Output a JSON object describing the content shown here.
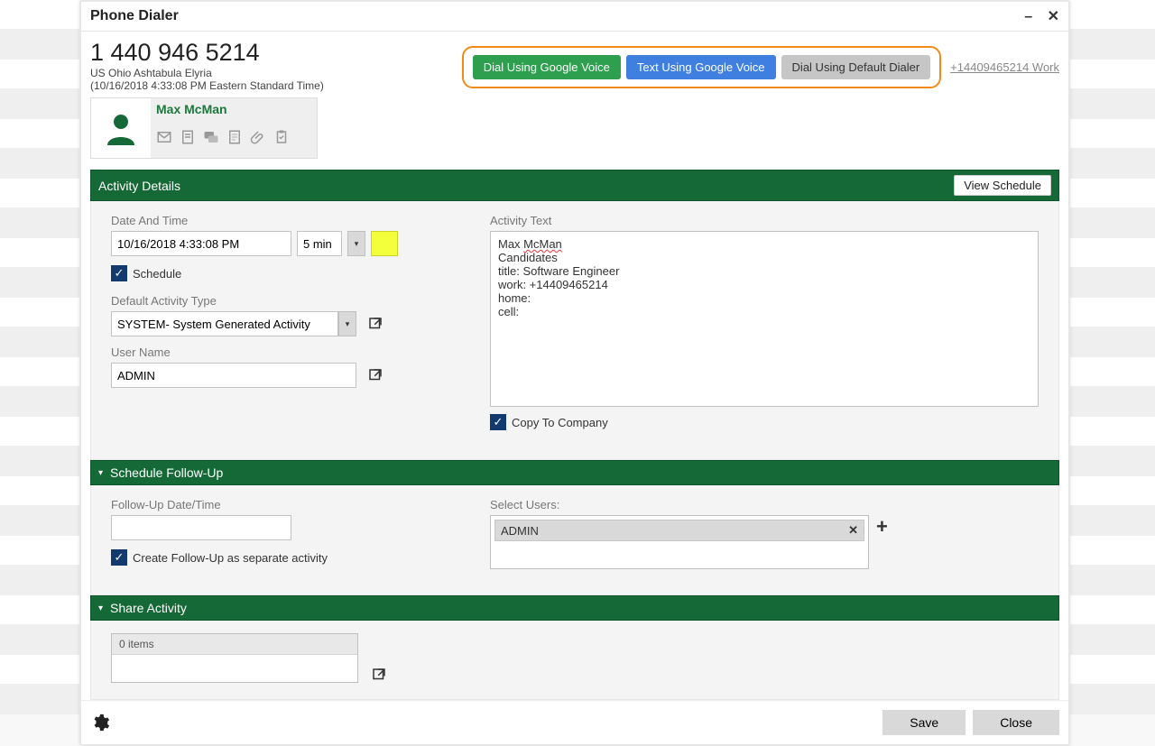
{
  "dialog": {
    "title": "Phone Dialer",
    "phone_display": "1 440 946 5214",
    "location": "US Ohio Ashtabula Elyria",
    "timestamp": "(10/16/2018 4:33:08 PM Eastern Standard Time)",
    "dial_google_voice": "Dial Using Google Voice",
    "text_google_voice": "Text Using Google Voice",
    "dial_default": "Dial Using Default Dialer",
    "phone_link": "+14409465214 Work"
  },
  "contact": {
    "name": "Max McMan"
  },
  "activity": {
    "section_title": "Activity Details",
    "view_schedule": "View Schedule",
    "date_label": "Date And Time",
    "date_value": "10/16/2018 4:33:08 PM",
    "duration": "5 min",
    "schedule_label": "Schedule",
    "type_label": "Default Activity Type",
    "type_value": "SYSTEM- System Generated Activity",
    "user_label": "User Name",
    "user_value": "ADMIN",
    "text_label": "Activity Text",
    "text_line1_a": "Max ",
    "text_line1_b": "McMan",
    "text_line2": "Candidates",
    "text_line3": "title: Software Engineer",
    "text_line4": "work: +14409465214",
    "text_line5": "home:",
    "text_line6": "cell:",
    "copy_company": "Copy To Company"
  },
  "followup": {
    "section_title": "Schedule Follow-Up",
    "date_label": "Follow-Up Date/Time",
    "separate_label": "Create Follow-Up as separate activity",
    "users_label": "Select Users:",
    "user_chip": "ADMIN"
  },
  "share": {
    "section_title": "Share Activity",
    "items_label": "0 items"
  },
  "footer": {
    "save": "Save",
    "close": "Close"
  }
}
